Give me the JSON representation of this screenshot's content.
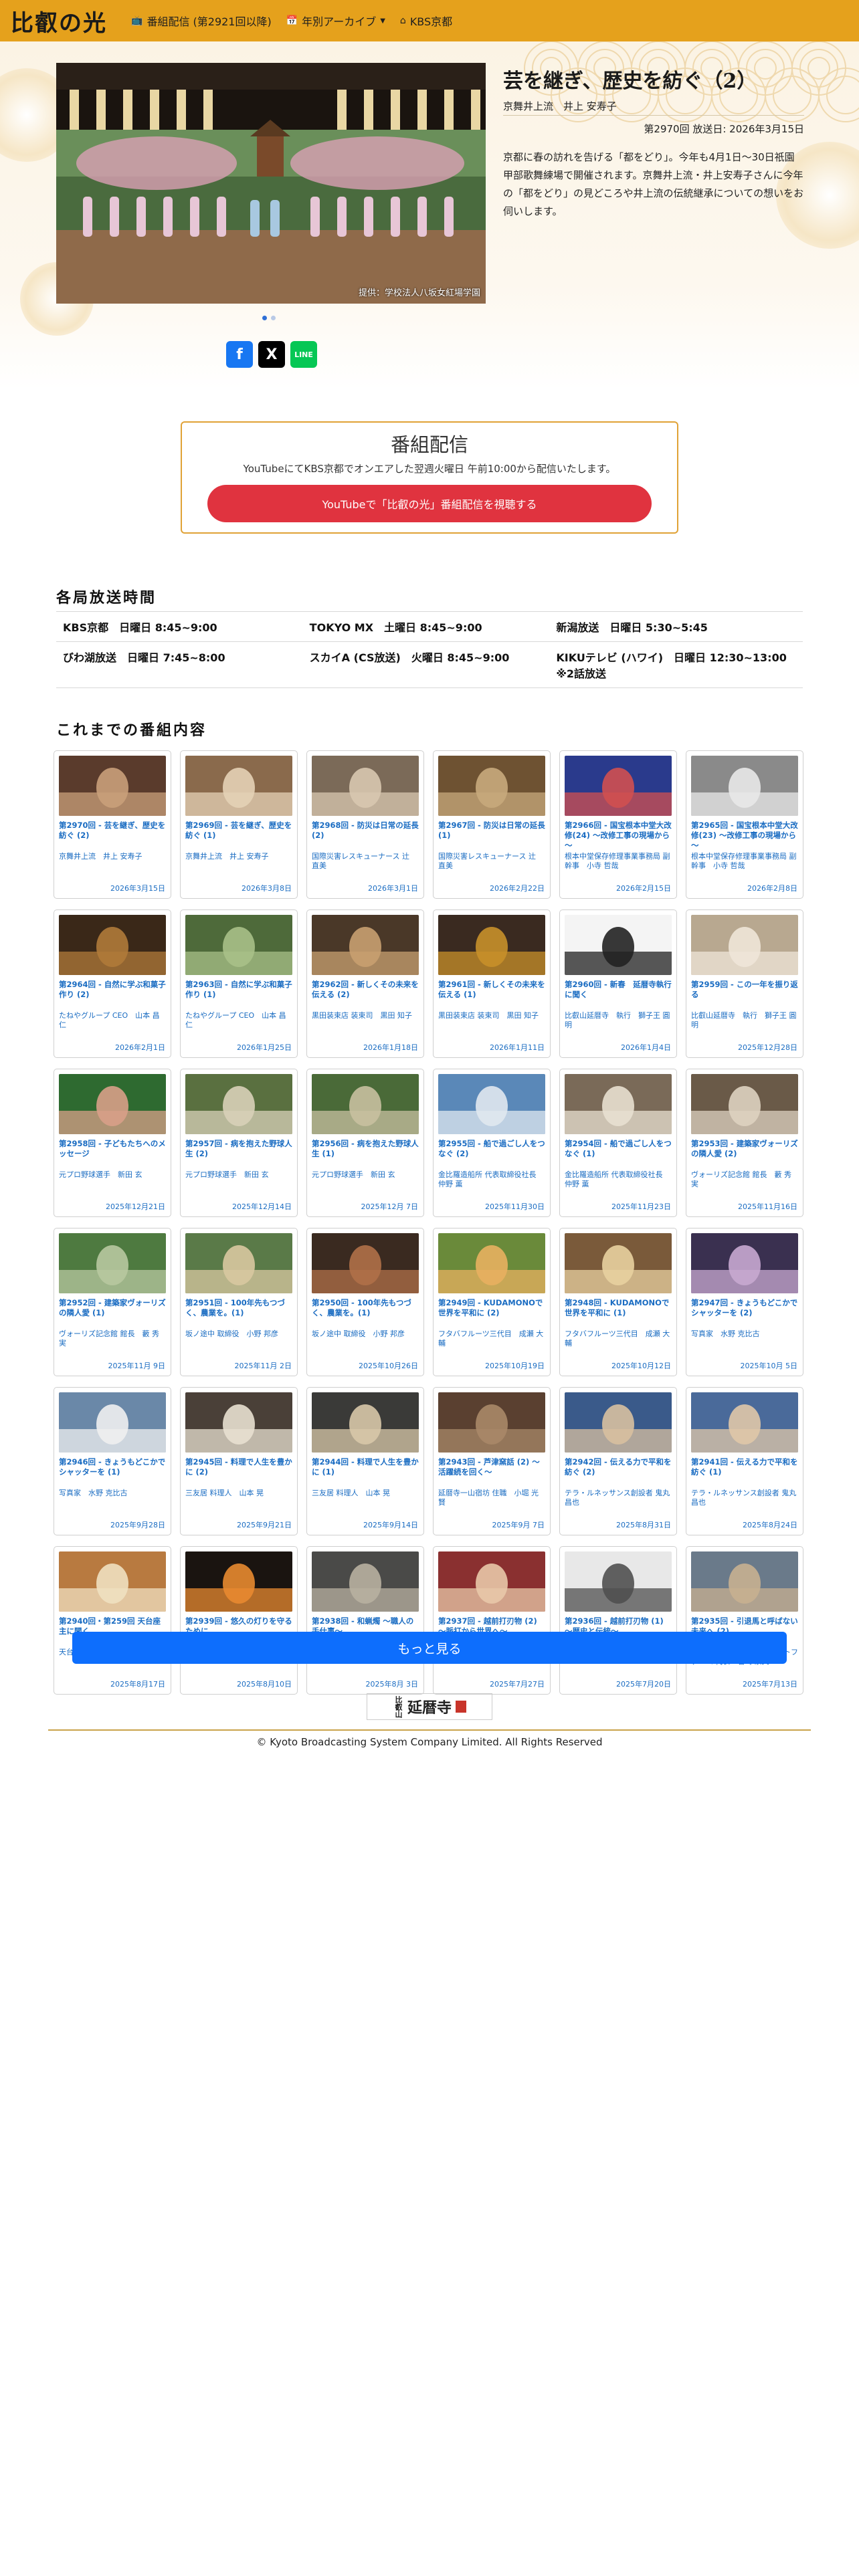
{
  "nav": {
    "brand": "比叡の光",
    "items": [
      {
        "label": "番組配信 (第2921回以降)",
        "icon": "tv-icon"
      },
      {
        "label": "年別アーカイブ",
        "icon": "calendar-icon"
      },
      {
        "label": "KBS京都",
        "icon": "home-icon"
      }
    ]
  },
  "hero": {
    "title": "芸を継ぎ、歴史を紡ぐ（2）",
    "subtitle": "京舞井上流　井上 安寿子",
    "meta": "第2970回 放送日: 2026年3月15日",
    "description": "京都に春の訪れを告げる「都をどり」。今年も4月1日～30日祇園甲部歌舞練場で開催されます。京舞井上流・井上安寿子さんに今年の「都をどり」の見どころや井上流の伝統継承についての想いをお伺いします。",
    "image_caption": "提供：学校法人八坂女紅場学園",
    "slide_count": 2,
    "active_slide": 1
  },
  "share": {
    "facebook": "f",
    "x": "X",
    "line": "LINE"
  },
  "streaming": {
    "title": "番組配信",
    "description": "YouTubeにてKBS京都でオンエアした翌週火曜日 午前10:00から配信いたします。",
    "button": "YouTubeで「比叡の光」番組配信を視聴する"
  },
  "broadcast": {
    "title": "各局放送時間",
    "rows": [
      [
        "KBS京都　日曜日 8:45~9:00",
        "TOKYO MX　土曜日 8:45~9:00",
        "新潟放送　日曜日 5:30~5:45"
      ],
      [
        "びわ湖放送　日曜日 7:45~8:00",
        "スカイA (CS放送)　火曜日 8:45~9:00",
        "KIKUテレビ (ハワイ)　日曜日 12:30~13:00 ※2話放送"
      ]
    ]
  },
  "episodes": {
    "title": "これまでの番組内容",
    "items": [
      {
        "title": "第2970回 - 芸を継ぎ、歴史を紡ぐ (2)",
        "guest": "京舞井上流　井上 安寿子",
        "date": "2026年3月15日",
        "c1": "#5a3b2c",
        "c2": "#c9a07a"
      },
      {
        "title": "第2969回 - 芸を継ぎ、歴史を紡ぐ (1)",
        "guest": "京舞井上流　井上 安寿子",
        "date": "2026年3月8日",
        "c1": "#8a6a4c",
        "c2": "#e4d2b6"
      },
      {
        "title": "第2968回 - 防災は日常の延長 (2)",
        "guest": "国際災害レスキューナース 辻 直美",
        "date": "2026年3月1日",
        "c1": "#7b6a58",
        "c2": "#d8c8b0"
      },
      {
        "title": "第2967回 - 防災は日常の延長 (1)",
        "guest": "国際災害レスキューナース 辻 直美",
        "date": "2026年2月22日",
        "c1": "#6e5232",
        "c2": "#c8aa7c"
      },
      {
        "title": "第2966回 - 国宝根本中堂大改修(24) ～改修工事の現場から～",
        "guest": "根本中堂保存修理事業事務局 副幹事　小寺 哲哉",
        "date": "2026年2月15日",
        "c1": "#2a3a8c",
        "c2": "#d05050"
      },
      {
        "title": "第2965回 - 国宝根本中堂大改修(23) ～改修工事の現場から～",
        "guest": "根本中堂保存修理事業事務局 副幹事　小寺 哲哉",
        "date": "2026年2月8日",
        "c1": "#8a8a8a",
        "c2": "#e8e8e8"
      },
      {
        "title": "第2964回 - 自然に学ぶ和菓子作り (2)",
        "guest": "たねやグループ CEO　山本 昌仁",
        "date": "2026年2月1日",
        "c1": "#3a2818",
        "c2": "#b07a3a"
      },
      {
        "title": "第2963回 - 自然に学ぶ和菓子作り (1)",
        "guest": "たねやグループ CEO　山本 昌仁",
        "date": "2026年1月25日",
        "c1": "#4e6a3a",
        "c2": "#a8c088"
      },
      {
        "title": "第2962回 - 新しくその未来を伝える (2)",
        "guest": "黒田装束店 装束司　黒田 知子",
        "date": "2026年1月18日",
        "c1": "#4a3828",
        "c2": "#c8a070"
      },
      {
        "title": "第2961回 - 新しくその未来を伝える (1)",
        "guest": "黒田装束店 装束司　黒田 知子",
        "date": "2026年1月11日",
        "c1": "#3a2a20",
        "c2": "#c8902a"
      },
      {
        "title": "第2960回 - 新春　延暦寺執行に聞く",
        "guest": "比叡山延暦寺　執行　獅子王 圓明",
        "date": "2026年1月4日",
        "c1": "#f4f4f4",
        "c2": "#222222"
      },
      {
        "title": "第2959回 - この一年を振り返る",
        "guest": "比叡山延暦寺　執行　獅子王 圓明",
        "date": "2025年12月28日",
        "c1": "#b8a890",
        "c2": "#efe6d8"
      },
      {
        "title": "第2958回 - 子どもたちへのメッセージ",
        "guest": "元プロ野球選手　新田 玄",
        "date": "2025年12月21日",
        "c1": "#2e6a30",
        "c2": "#d8a088"
      },
      {
        "title": "第2957回 - 病を抱えた野球人生 (2)",
        "guest": "元プロ野球選手　新田 玄",
        "date": "2025年12月14日",
        "c1": "#5a7040",
        "c2": "#d8d0b8"
      },
      {
        "title": "第2956回 - 病を抱えた野球人生 (1)",
        "guest": "元プロ野球選手　新田 玄",
        "date": "2025年12月 7日",
        "c1": "#4a6a38",
        "c2": "#c8c0a0"
      },
      {
        "title": "第2955回 - 船で過ごし人をつなぐ (2)",
        "guest": "金比羅造船所 代表取締役社長 仲野 薫",
        "date": "2025年11月30日",
        "c1": "#5a88b8",
        "c2": "#e0e8f0"
      },
      {
        "title": "第2954回 - 船で過ごし人をつなぐ (1)",
        "guest": "金比羅造船所 代表取締役社長 仲野 薫",
        "date": "2025年11月23日",
        "c1": "#7a6a58",
        "c2": "#e8e0d0"
      },
      {
        "title": "第2953回 - 建築家ヴォーリズの隣人愛 (2)",
        "guest": "ヴォーリズ記念館 館長　藪 秀実",
        "date": "2025年11月16日",
        "c1": "#6a5a48",
        "c2": "#ded2c0"
      },
      {
        "title": "第2952回 - 建築家ヴォーリズの隣人愛 (1)",
        "guest": "ヴォーリズ記念館 館長　藪 秀実",
        "date": "2025年11月 9日",
        "c1": "#4e7a40",
        "c2": "#b8c8a0"
      },
      {
        "title": "第2951回 - 100年先もつづく、農業を。(1)",
        "guest": "坂ノ途中 取締役　小野 邦彦",
        "date": "2025年11月 2日",
        "c1": "#5a7a48",
        "c2": "#d8c8a0"
      },
      {
        "title": "第2950回 - 100年先もつづく、農業を。(1)",
        "guest": "坂ノ途中 取締役　小野 邦彦",
        "date": "2025年10月26日",
        "c1": "#3a2a20",
        "c2": "#b07048"
      },
      {
        "title": "第2949回 - KUDAMONOで世界を平和に (2)",
        "guest": "フタバフルーツ三代目　成瀬 大輔",
        "date": "2025年10月19日",
        "c1": "#6a8a3a",
        "c2": "#e8b060"
      },
      {
        "title": "第2948回 - KUDAMONOで世界を平和に (1)",
        "guest": "フタバフルーツ三代目　成瀬 大輔",
        "date": "2025年10月12日",
        "c1": "#7a5a3a",
        "c2": "#e8d0a0"
      },
      {
        "title": "第2947回 - きょうもどこかでシャッターを (2)",
        "guest": "写真家　水野 克比古",
        "date": "2025年10月 5日",
        "c1": "#3a3050",
        "c2": "#c8a8d0"
      },
      {
        "title": "第2946回 - きょうもどこかでシャッターを (1)",
        "guest": "写真家　水野 克比古",
        "date": "2025年9月28日",
        "c1": "#6a88a8",
        "c2": "#f0f0f0"
      },
      {
        "title": "第2945回 - 料理で人生を豊かに (2)",
        "guest": "三友居 料理人　山本 晃",
        "date": "2025年9月21日",
        "c1": "#4a4038",
        "c2": "#e8e0d0"
      },
      {
        "title": "第2944回 - 料理で人生を豊かに (1)",
        "guest": "三友居 料理人　山本 晃",
        "date": "2025年9月14日",
        "c1": "#3a3a38",
        "c2": "#d8c8a8"
      },
      {
        "title": "第2943回 - 芦津窯話 (2) ～活躍続を回く～",
        "guest": "延暦寺一山宿坊 住職　小堀 光賢",
        "date": "2025年9月 7日",
        "c1": "#5a4030",
        "c2": "#a88868"
      },
      {
        "title": "第2942回 - 伝える力で平和を紡ぐ (2)",
        "guest": "テラ・ルネッサンス創設者 鬼丸 昌也",
        "date": "2025年8月31日",
        "c1": "#3a5a8a",
        "c2": "#d8c0a0"
      },
      {
        "title": "第2941回 - 伝える力で平和を紡ぐ (1)",
        "guest": "テラ・ルネッサンス創設者 鬼丸 昌也",
        "date": "2025年8月24日",
        "c1": "#4a6a9a",
        "c2": "#e0c8a8"
      },
      {
        "title": "第2940回・第259回 天台座主に聞く",
        "guest": "天台座主　藤 光賢 猊下",
        "date": "2025年8月17日",
        "c1": "#b87a40",
        "c2": "#f0e0c0"
      },
      {
        "title": "第2939回 - 悠久の灯りを守るために",
        "guest": "中村ローソク　田川 広一",
        "date": "2025年8月10日",
        "c1": "#1a1410",
        "c2": "#e88a30"
      },
      {
        "title": "第2938回 - 和蝋燭 ～職人の手仕事～",
        "guest": "中村ローソク　田川 広一",
        "date": "2025年8月 3日",
        "c1": "#4a4a48",
        "c2": "#b8b0a0"
      },
      {
        "title": "第2937回 - 越前打刃物 (2) ～脈打から世界へ～",
        "guest": "安立打刃物5代目　池田 拓明",
        "date": "2025年7月27日",
        "c1": "#8a3030",
        "c2": "#e8c8a8"
      },
      {
        "title": "第2936回 - 越前打刃物 (1) ～歴史と伝統～",
        "guest": "安立打刃物5代目　池田 拓明",
        "date": "2025年7月20日",
        "c1": "#e8e8e8",
        "c2": "#505050"
      },
      {
        "title": "第2935回 - 引退馬と呼ばない未来へ (2)",
        "guest": "Yogibo ヴェルサイユリゾートファーム 代表　岩崎 崇文",
        "date": "2025年7月13日",
        "c1": "#6a7a8a",
        "c2": "#c8b090"
      }
    ]
  },
  "more_button": "もっと見る",
  "footer": {
    "sponsor_small": "比叡山",
    "sponsor_name": "延暦寺",
    "copyright": "© Kyoto Broadcasting System Company Limited. All Rights Reserved"
  }
}
